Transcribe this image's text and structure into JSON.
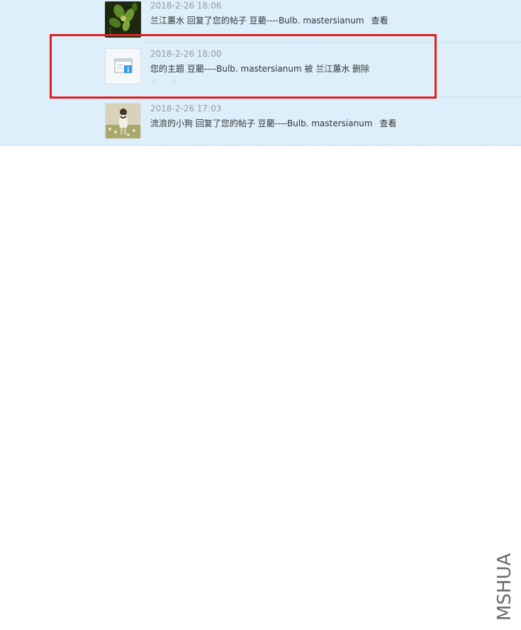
{
  "notices": [
    {
      "time": "2018-2-26 18:06",
      "text": "兰江蕙水 回复了您的帖子 豆藺----Bulb. mastersianum",
      "action": "查看",
      "avatar_icon": "orchid-photo-avatar"
    },
    {
      "time": "2018-2-26 18:00",
      "text": "您的主题 豆藺----Bulb. mastersianum 被 兰江蕙水 删除",
      "quote_marks": "“ ”",
      "avatar_icon": "system-notice-icon"
    },
    {
      "time": "2018-2-26 17:03",
      "text": "流浪的小狗 回复了您的帖子 豆藺----Bulb. mastersianum",
      "action": "查看",
      "avatar_icon": "person-photo-avatar"
    }
  ],
  "watermark": "MSHUA",
  "colors": {
    "list_background": "#ddeffb",
    "highlight": "#e02020",
    "time_text": "#999999"
  }
}
